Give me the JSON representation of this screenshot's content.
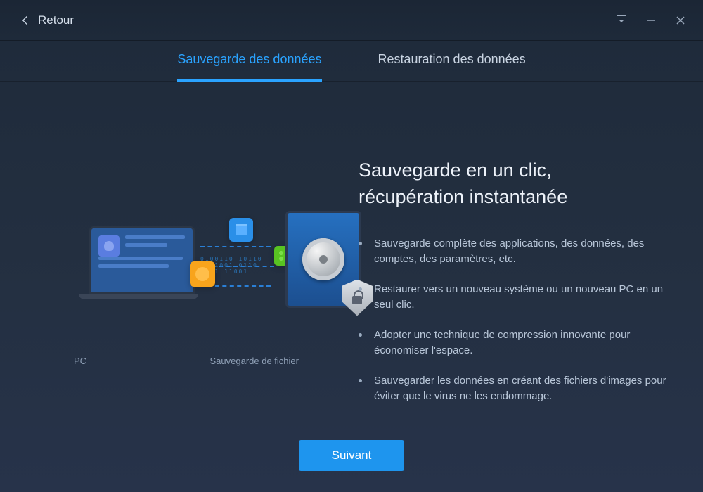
{
  "titlebar": {
    "back_label": "Retour"
  },
  "tabs": {
    "backup": "Sauvegarde des données",
    "restore": "Restauration des données"
  },
  "illustration": {
    "pc_label": "PC",
    "file_backup_label": "Sauvegarde de fichier"
  },
  "headline": "Sauvegarde en un clic,\nrécupération instantanée",
  "bullets": [
    "Sauvegarde complète des applications, des données, des comptes, des paramètres, etc.",
    "Restaurer vers un nouveau système ou un nouveau PC en un seul clic.",
    "Adopter une technique de compression innovante pour économiser l'espace.",
    "Sauvegarder les données en créant des fichiers d'images pour éviter que le virus ne les endommage."
  ],
  "footer": {
    "next_label": "Suivant"
  }
}
